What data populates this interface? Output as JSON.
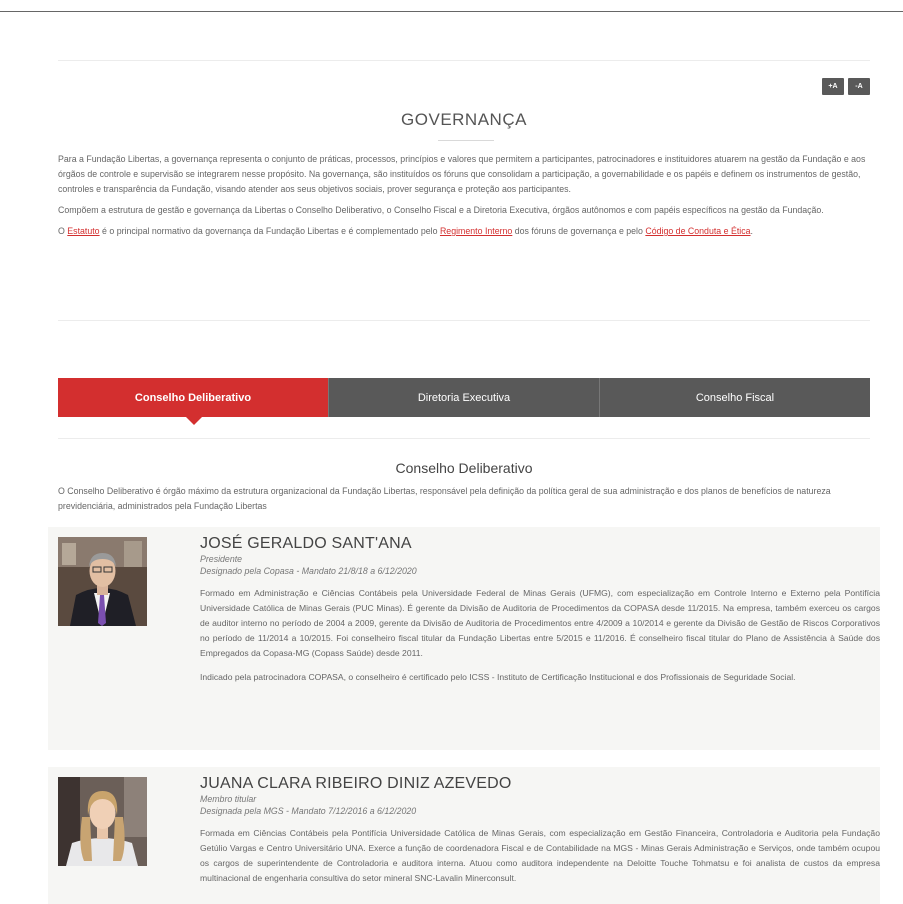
{
  "font_controls": {
    "increase": "+A",
    "decrease": "-A"
  },
  "page": {
    "title": "GOVERNANÇA",
    "intro_p1": "Para a Fundação Libertas, a governança representa o conjunto de práticas, processos, princípios e valores que permitem a participantes, patrocinadores e instituidores atuarem na gestão da Fundação e aos órgãos de controle e supervisão se integrarem nesse propósito. Na governança, são instituídos os fóruns que consolidam a participação, a governabilidade e os papéis e definem os instrumentos de gestão, controles e transparência da Fundação, visando atender aos seus objetivos sociais, prover segurança e proteção aos participantes.",
    "intro_p2": "Compõem a estrutura de gestão e governança da Libertas o Conselho Deliberativo, o Conselho Fiscal e a Diretoria Executiva, órgãos autônomos e com papéis específicos na gestão da Fundação.",
    "intro_p3_a": "O ",
    "link_estatuto": "Estatuto",
    "intro_p3_b": " é o principal normativo da governança da Fundação Libertas e é complementado pelo ",
    "link_regimento": "Regimento Interno",
    "intro_p3_c": " dos fóruns de governança e pelo ",
    "link_codigo": "Código de Conduta e Ética",
    "intro_p3_d": "."
  },
  "tabs": [
    {
      "label": "Conselho Deliberativo"
    },
    {
      "label": "Diretoria Executiva"
    },
    {
      "label": "Conselho Fiscal"
    }
  ],
  "section": {
    "title": "Conselho Deliberativo",
    "description": "O Conselho Deliberativo é órgão máximo da estrutura organizacional da Fundação Libertas, responsável pela definição da política geral de sua administração e dos planos de benefícios de natureza previdenciária, administrados pela Fundação Libertas"
  },
  "members": [
    {
      "name": "JOSÉ GERALDO SANT'ANA",
      "role": "Presidente",
      "mandate": "Designado pela Copasa - Mandato 21/8/18 a 6/12/2020",
      "bio_p1": "Formado em Administração e Ciências Contábeis pela Universidade Federal de Minas Gerais (UFMG), com especialização em Controle Interno e Externo pela Pontifícia Universidade Católica de Minas Gerais (PUC Minas). É gerente da Divisão de Auditoria de Procedimentos da COPASA desde 11/2015. Na empresa, também exerceu os cargos de auditor interno no período de 2004 a 2009, gerente da Divisão de Auditoria de Procedimentos entre 4/2009 a 10/2014 e gerente da Divisão de Gestão de Riscos Corporativos no período de 11/2014 a 10/2015. Foi conselheiro fiscal titular da Fundação Libertas entre 5/2015 e 11/2016. É conselheiro fiscal titular do Plano de Assistência à Saúde dos Empregados da Copasa-MG (Copass Saúde) desde 2011.",
      "bio_p2": "Indicado pela patrocinadora COPASA, o conselheiro é certificado pelo ICSS - Instituto de Certificação Institucional e dos Profissionais de Seguridade Social."
    },
    {
      "name": "JUANA CLARA RIBEIRO DINIZ AZEVEDO",
      "role": "Membro titular",
      "mandate": "Designada pela MGS - Mandato 7/12/2016 a 6/12/2020",
      "bio_p1": "Formada em Ciências Contábeis pela Pontifícia Universidade Católica de Minas Gerais, com especialização em Gestão Financeira, Controladoria e Auditoria pela Fundação Getúlio Vargas e Centro Universitário UNA. Exerce a função de coordenadora Fiscal e de Contabilidade na MGS - Minas Gerais Administração e Serviços, onde também ocupou os cargos de superintendente de Controladoria e auditora interna. Atuou como auditora independente na Deloitte Touche Tohmatsu e foi analista de custos da empresa multinacional de engenharia consultiva do setor mineral SNC-Lavalin Minerconsult."
    }
  ]
}
